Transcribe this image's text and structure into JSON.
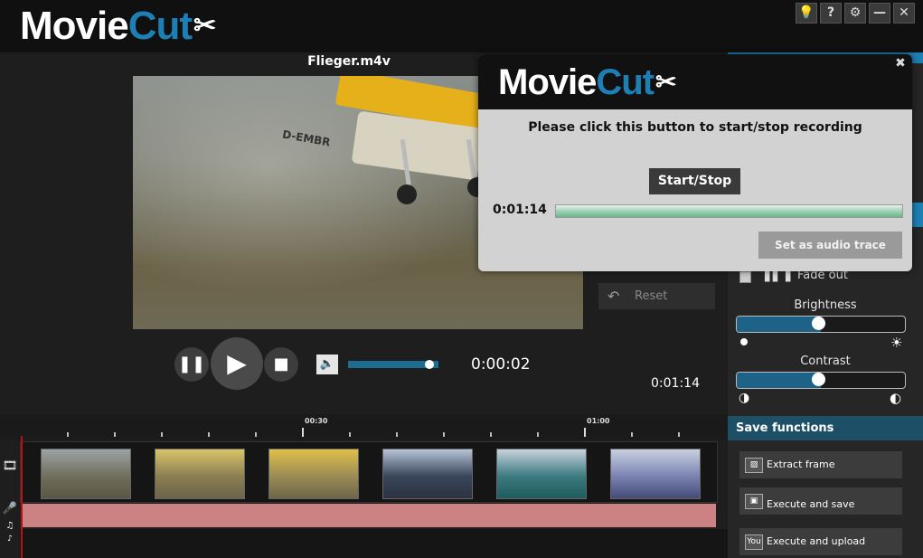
{
  "app": {
    "logo_part1": "Movie",
    "logo_part2": "Cut",
    "window_buttons": [
      "lightbulb-icon",
      "help-icon",
      "gear-icon",
      "minimize-icon",
      "close-icon"
    ]
  },
  "player": {
    "file_name": "Flieger.m4v",
    "video_overlay_text": "D-EMBR",
    "current_time": "0:00:02",
    "total_time": "0:01:14",
    "volume_fraction": 0.9
  },
  "effects": {
    "reset_label": "Reset",
    "fade_out_label": "Fade out",
    "brightness_label": "Brightness",
    "brightness_value": 0.5,
    "contrast_label": "Contrast",
    "contrast_value": 0.5
  },
  "save": {
    "header": "Save functions",
    "extract_frame": "Extract frame",
    "execute_save": "Execute and save",
    "execute_upload": "Execute and upload",
    "youtube_icon_text": "You"
  },
  "timeline": {
    "labels": [
      "00:30",
      "01:00"
    ],
    "frame_count": 6
  },
  "popup": {
    "logo_part1": "Movie",
    "logo_part2": "Cut",
    "message": "Please click this button to start/stop recording",
    "start_stop_label": "Start/Stop",
    "recorded_time": "0:01:14",
    "set_audio_trace_label": "Set as audio trace"
  },
  "colors": {
    "accent": "#1d7fb3",
    "audio_track": "#cc8282",
    "slider_fill": "#1d6387"
  }
}
